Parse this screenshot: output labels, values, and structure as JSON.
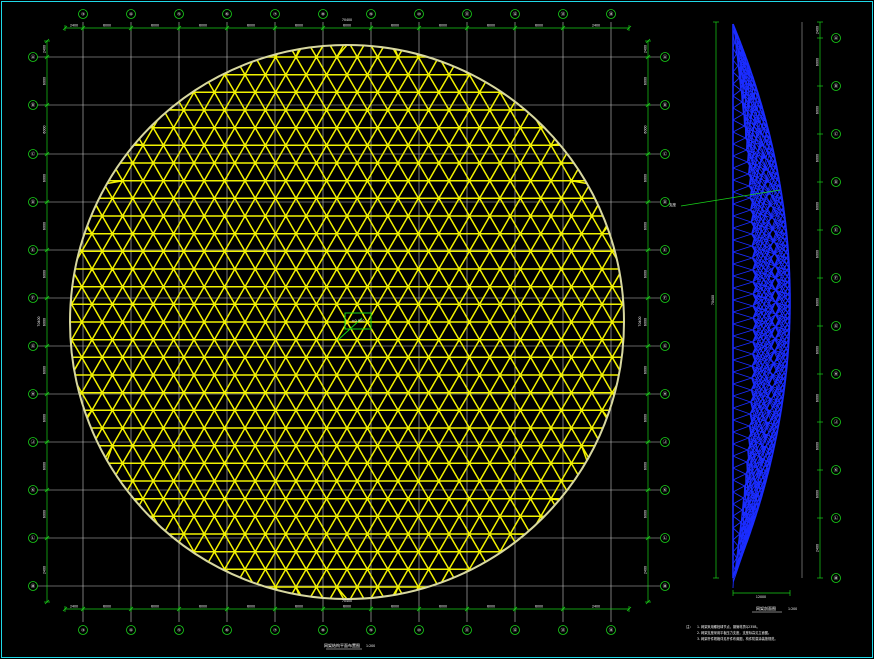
{
  "canvas": {
    "background": "#000000"
  },
  "colors": {
    "border": "#1fd8e8",
    "grid": "#c8c8c8",
    "dimension": "#19d219",
    "dome_ring": "#d8d8a0",
    "dome_members": "#f2f200",
    "section_members": "#1a2cff",
    "annotation": "#ffffff"
  },
  "axes": {
    "columns": [
      "③",
      "④",
      "⑤",
      "⑥",
      "⑦",
      "⑧",
      "⑨",
      "⑩",
      "⑪",
      "⑫",
      "⑬",
      "⑭"
    ],
    "rows": [
      "Ⓐ",
      "Ⓑ",
      "Ⓒ",
      "Ⓓ",
      "Ⓔ",
      "Ⓕ",
      "Ⓖ",
      "Ⓗ",
      "Ⓙ",
      "Ⓚ",
      "Ⓛ",
      "Ⓜ"
    ]
  },
  "plan": {
    "top_dims": [
      "2400",
      "6000",
      "6000",
      "6000",
      "6000",
      "6000",
      "6000",
      "6000",
      "6000",
      "6000",
      "6000",
      "2400"
    ],
    "bottom_dims": [
      "2400",
      "6000",
      "6000",
      "6000",
      "6000",
      "6000",
      "6000",
      "6000",
      "6000",
      "6000",
      "6000",
      "2400"
    ],
    "left_dims": [
      "2400",
      "6000",
      "6000",
      "6000",
      "6000",
      "6000",
      "6000",
      "6000",
      "6000",
      "6000",
      "6000",
      "2400"
    ],
    "right_dims": [
      "2400",
      "6000",
      "6000",
      "6000",
      "6000",
      "6000",
      "6000",
      "6000",
      "6000",
      "6000",
      "6000",
      "2400"
    ],
    "overall_top": "70400",
    "overall_bottom": "70400",
    "overall_left": "70400",
    "overall_right": "70400",
    "center_label": "±0.000",
    "title": "网架结构平面布置图",
    "scale": "1:200"
  },
  "section": {
    "dims": [
      "2400",
      "6000",
      "6000",
      "6000",
      "6000",
      "6000",
      "6000",
      "6000",
      "6000",
      "6000",
      "6000",
      "2400"
    ],
    "height_dim": "70400",
    "width_dim": "12000",
    "arrow_label": "支座",
    "title": "网架剖面图",
    "scale": "1:200"
  },
  "notes": {
    "prefix": "注：",
    "lines": [
      "1. 网架采用螺栓球节点，钢管材质Q235B。",
      "2. 网架支座采用平板压力支座，支座标高见立面图。",
      "3. 网架杆件规格详见杆件布置图，构件防腐涂装按规范。"
    ]
  }
}
